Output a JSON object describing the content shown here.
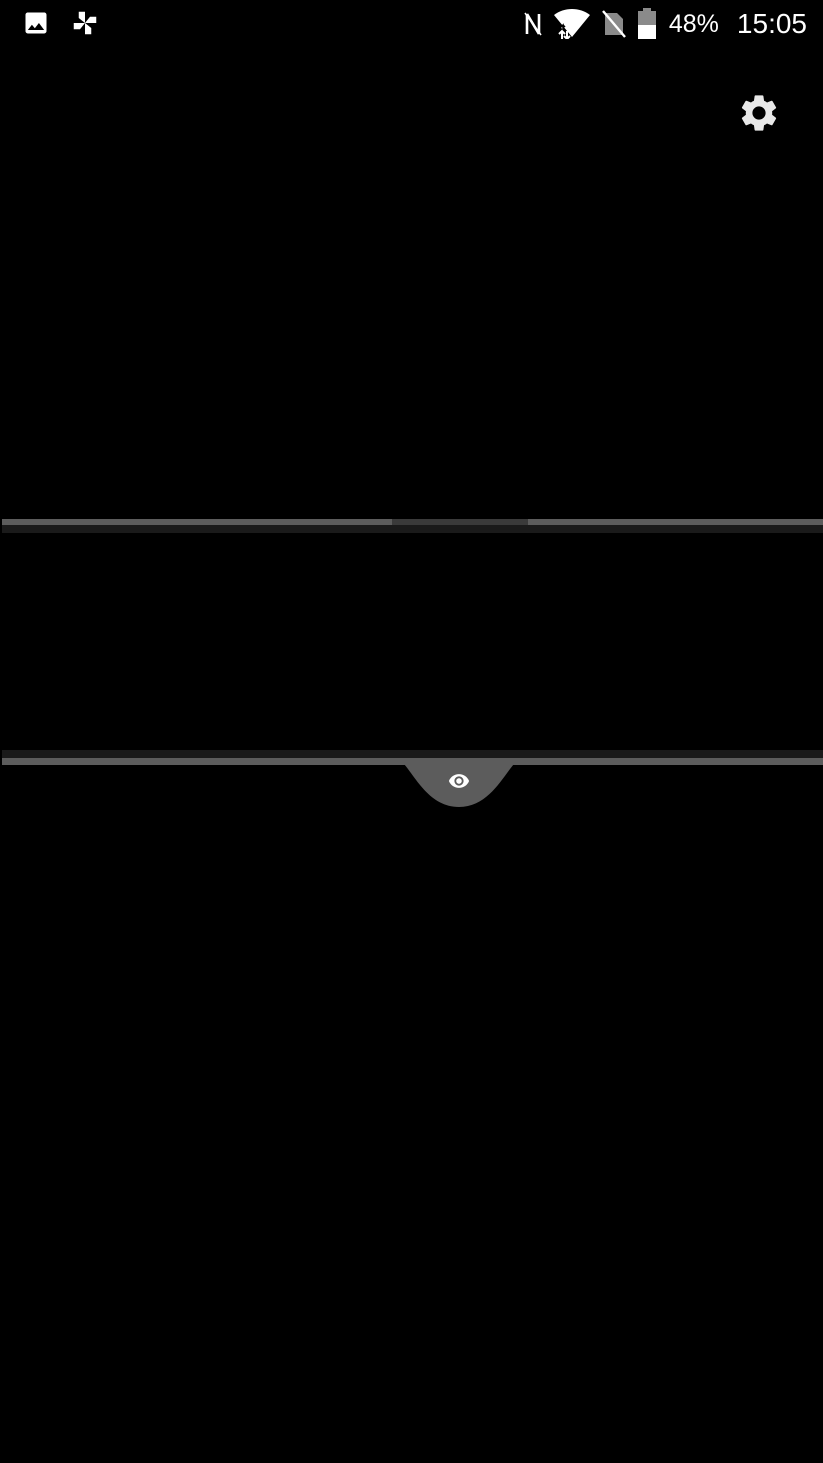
{
  "status_bar": {
    "left_icons": [
      "gallery-notification-icon",
      "pinwheel-app-icon"
    ],
    "right_icons": [
      "nfc-icon",
      "wifi-icon",
      "no-sim-icon",
      "battery-icon"
    ],
    "battery_percent": "48%",
    "time": "15:05"
  },
  "toolbar": {
    "settings_icon": "gear-icon"
  },
  "mask": {
    "reveal_icon": "eye-icon"
  },
  "colors": {
    "background": "#000000",
    "status_text": "#ffffff",
    "icon": "#e8e8e8",
    "edge_line": "#5c5c5c",
    "edge_shadow": "#1a1a1a",
    "tab_fill": "#5c5c5c"
  }
}
